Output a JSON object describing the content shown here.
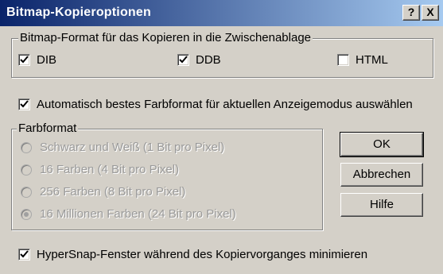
{
  "window": {
    "title": "Bitmap-Kopieroptionen",
    "help_button": "?",
    "close_button": "X"
  },
  "format_group": {
    "label": "Bitmap-Format für das Kopieren in die Zwischenablage",
    "options": [
      {
        "label": "DIB",
        "checked": true
      },
      {
        "label": "DDB",
        "checked": true
      },
      {
        "label": "HTML",
        "checked": false
      }
    ]
  },
  "auto_format": {
    "label": "Automatisch bestes Farbformat für aktuellen Anzeigemodus auswählen",
    "checked": true
  },
  "color_group": {
    "label": "Farbformat",
    "options": [
      {
        "label": "Schwarz und Weiß (1 Bit pro Pixel)",
        "selected": false
      },
      {
        "label": "16 Farben (4 Bit pro Pixel)",
        "selected": false
      },
      {
        "label": "256 Farben (8 Bit pro Pixel)",
        "selected": false
      },
      {
        "label": "16 Millionen Farben (24 Bit pro Pixel)",
        "selected": true
      }
    ]
  },
  "buttons": {
    "ok": "OK",
    "cancel": "Abbrechen",
    "help": "Hilfe"
  },
  "minimize": {
    "label": "HyperSnap-Fenster während  des Kopiervorganges minimieren",
    "checked": true
  }
}
